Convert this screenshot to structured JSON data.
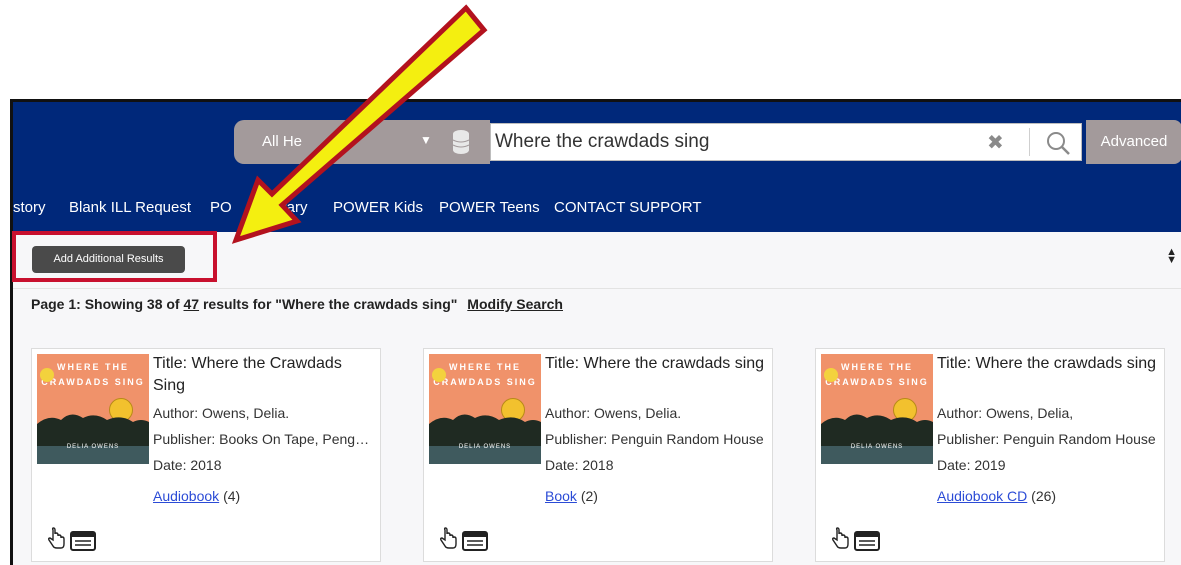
{
  "search": {
    "scope_label": "All He",
    "query": "Where the crawdads sing",
    "advanced_label": "Advanced"
  },
  "nav": {
    "items": [
      "story",
      "Blank ILL Request",
      "PO",
      "ibrary",
      "POWER Kids",
      "POWER Teens",
      "CONTACT SUPPORT"
    ]
  },
  "toolbar": {
    "add_results_label": "Add Additional Results"
  },
  "results": {
    "prefix": "Page 1: Showing 38 of",
    "total": "47",
    "suffix": "results for \"Where the crawdads sing\"",
    "modify_label": "Modify Search"
  },
  "cover": {
    "top_text": "WHERE THE CRAWDADS SING",
    "author_text": "DELIA OWENS"
  },
  "cards": [
    {
      "title": "Title: Where the Crawdads Sing",
      "author": "Author: Owens, Delia.",
      "publisher": "Publisher: Books On Tape, Pengui...",
      "date": "Date: 2018",
      "format_link": "Audiobook",
      "format_count": "(4)"
    },
    {
      "title": "Title: Where the crawdads sing",
      "author": "Author: Owens, Delia.",
      "publisher": "Publisher: Penguin Random House",
      "date": "Date: 2018",
      "format_link": "Book",
      "format_count": "(2)"
    },
    {
      "title": "Title: Where the crawdads sing",
      "author": "Author: Owens, Delia,",
      "publisher": "Publisher: Penguin Random House",
      "date": "Date: 2019",
      "format_link": "Audiobook CD",
      "format_count": "(26)"
    }
  ],
  "colors": {
    "header_bg": "#00287a",
    "annotation_red": "#c8102e",
    "arrow_yellow": "#f4ef10",
    "link_blue": "#2b4bd6"
  }
}
